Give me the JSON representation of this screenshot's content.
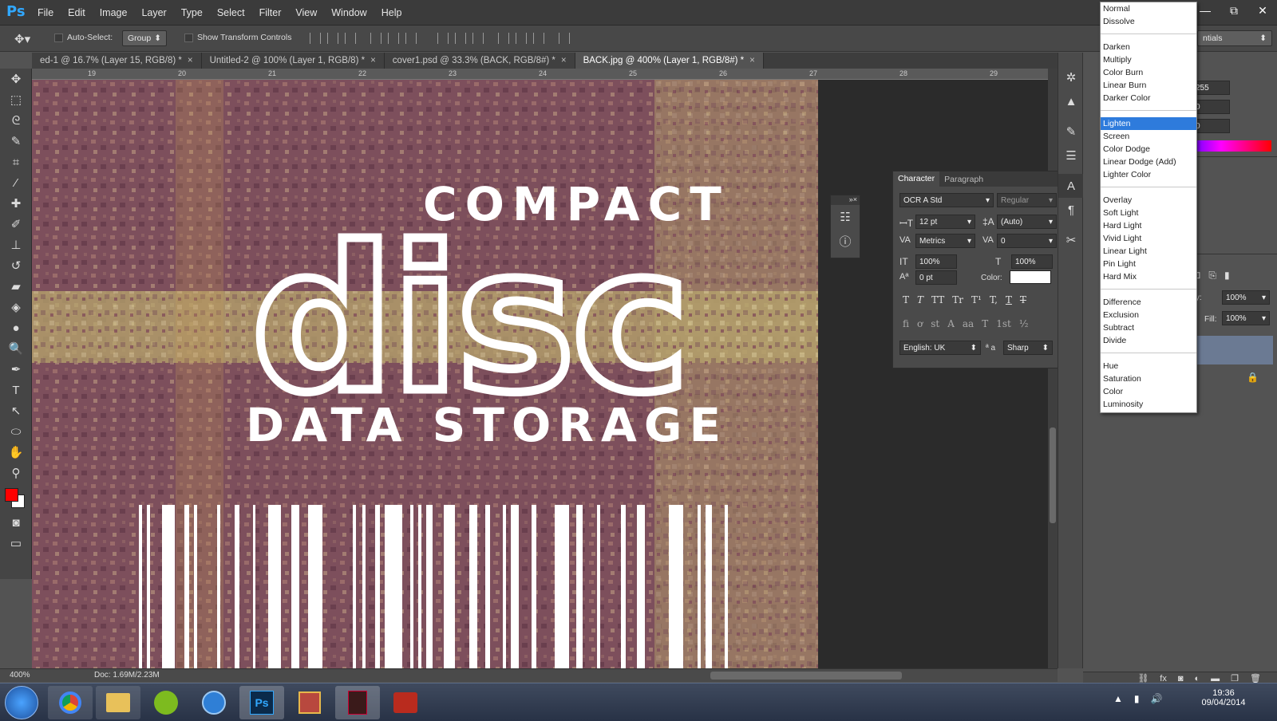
{
  "app": {
    "logo": "Ps"
  },
  "menu": [
    "File",
    "Edit",
    "Image",
    "Layer",
    "Type",
    "Select",
    "Filter",
    "View",
    "Window",
    "Help"
  ],
  "window_controls": [
    "—",
    "⧉",
    "✕"
  ],
  "options_bar": {
    "auto_select_label": "Auto-Select:",
    "auto_select_value": "Group",
    "show_transform_label": "Show Transform Controls"
  },
  "tabs": [
    {
      "label": "ed-1 @ 16.7% (Layer 15, RGB/8) *",
      "active": false
    },
    {
      "label": "Untitled-2 @ 100% (Layer 1, RGB/8) *",
      "active": false
    },
    {
      "label": "cover1.psd @ 33.3% (BACK, RGB/8#) *",
      "active": false
    },
    {
      "label": "BACK.jpg @ 400% (Layer 1, RGB/8#) *",
      "active": true
    }
  ],
  "ruler_h": [
    "19",
    "20",
    "21",
    "22",
    "23",
    "24",
    "25",
    "26",
    "27",
    "28",
    "29"
  ],
  "canvas": {
    "logo_top": "COMPACT",
    "logo_mid": "disc",
    "logo_bottom": "DATA STORAGE"
  },
  "status": {
    "zoom": "400%",
    "doc": "Doc: 1.69M/2.23M"
  },
  "character_panel": {
    "tab_character": "Character",
    "tab_paragraph": "Paragraph",
    "font_family": "OCR A Std",
    "font_style": "Regular",
    "font_size": "12 pt",
    "leading": "(Auto)",
    "kerning": "Metrics",
    "tracking": "0",
    "vscale": "100%",
    "hscale": "100%",
    "baseline": "0 pt",
    "color_label": "Color:",
    "language": "English: UK",
    "aa_label": "ª a",
    "antialias": "Sharp",
    "type_buttons": [
      "T",
      "T",
      "TT",
      "Tr",
      "T¹",
      "T,",
      "T",
      "T"
    ],
    "ot_buttons": [
      "fi",
      "ơ",
      "st",
      "A",
      "aa",
      "T",
      "1st",
      "½"
    ]
  },
  "color_panel": {
    "r": "255",
    "g": "0",
    "b": "0"
  },
  "layers_panel": {
    "opacity_label": "Opacity:",
    "opacity": "100%",
    "fill_label": "Fill:",
    "fill": "100%"
  },
  "right_dropdown": "ntials",
  "blend_modes": [
    [
      "Normal",
      "Dissolve"
    ],
    [
      "Darken",
      "Multiply",
      "Color Burn",
      "Linear Burn",
      "Darker Color"
    ],
    [
      "Lighten",
      "Screen",
      "Color Dodge",
      "Linear Dodge (Add)",
      "Lighter Color"
    ],
    [
      "Overlay",
      "Soft Light",
      "Hard Light",
      "Vivid Light",
      "Linear Light",
      "Pin Light",
      "Hard Mix"
    ],
    [
      "Difference",
      "Exclusion",
      "Subtract",
      "Divide"
    ],
    [
      "Hue",
      "Saturation",
      "Color",
      "Luminosity"
    ]
  ],
  "blend_selected": "Lighten",
  "taskbar": {
    "apps": [
      "chrome",
      "explorer",
      "spotify",
      "itunes",
      "Ps",
      "winrar",
      "media",
      "filezilla"
    ],
    "time": "19:36",
    "date": "09/04/2014"
  },
  "colors": {
    "foreground": "#ff0000",
    "background": "#ffffff",
    "accent": "#2e7bdc"
  }
}
